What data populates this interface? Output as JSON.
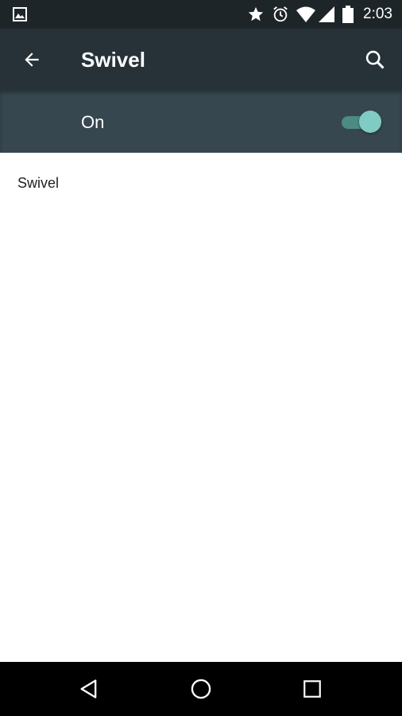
{
  "status_bar": {
    "time": "2:03",
    "icons": [
      "image-notification-icon",
      "star-icon",
      "alarm-icon",
      "wifi-icon",
      "cell-signal-icon",
      "battery-icon"
    ]
  },
  "toolbar": {
    "title": "Swivel",
    "back_icon": "arrow-back-icon",
    "search_icon": "search-icon"
  },
  "master_switch": {
    "label": "On",
    "checked": true,
    "accent_color": "#80cbc4"
  },
  "content": {
    "items": [
      {
        "label": "Swivel"
      }
    ]
  },
  "nav_bar": {
    "icons": [
      "nav-back-icon",
      "nav-home-icon",
      "nav-recents-icon"
    ]
  },
  "colors": {
    "status_bar": "#1e2529",
    "toolbar": "#263238",
    "switch_bar": "#37474f",
    "background": "#ffffff",
    "nav_bar": "#000000"
  }
}
